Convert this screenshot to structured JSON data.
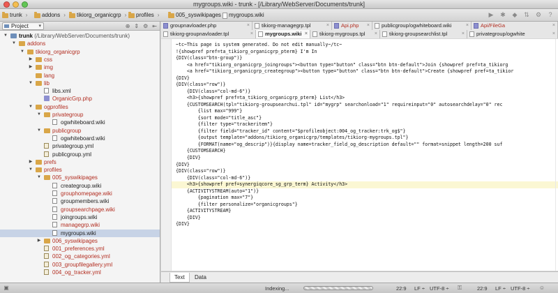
{
  "window": {
    "title": "mygroups.wiki - trunk - [/Library/WebServer/Documents/trunk]"
  },
  "breadcrumb": [
    "trunk",
    "addons",
    "tikiorg_organicgrp",
    "profiles",
    "005_syswikipages",
    "mygroups.wiki"
  ],
  "project_pane": {
    "view_label": "Project",
    "tree": [
      {
        "label": "trunk",
        "path": " (/Library/WebServer/Documents/trunk)",
        "depth": 0,
        "arrow": "▼",
        "icon": "folder-blue",
        "style": "bold"
      },
      {
        "label": "addons",
        "depth": 1,
        "arrow": "▼",
        "icon": "folder-yellow",
        "style": "red"
      },
      {
        "label": "tikiorg_organicgrp",
        "depth": 2,
        "arrow": "▼",
        "icon": "folder-yellow",
        "style": "red"
      },
      {
        "label": "css",
        "depth": 3,
        "arrow": "▶",
        "icon": "folder-yellow",
        "style": "red"
      },
      {
        "label": "img",
        "depth": 3,
        "arrow": "▶",
        "icon": "folder-yellow",
        "style": "red"
      },
      {
        "label": "lang",
        "depth": 3,
        "arrow": "",
        "icon": "folder-yellow",
        "style": "red"
      },
      {
        "label": "lib",
        "depth": 3,
        "arrow": "▼",
        "icon": "folder-yellow",
        "style": "red"
      },
      {
        "label": "libs.xml",
        "depth": 4,
        "arrow": "",
        "icon": "file-doc",
        "style": "normal"
      },
      {
        "label": "OrganicGrp.php",
        "depth": 4,
        "arrow": "",
        "icon": "file-php",
        "style": "red"
      },
      {
        "label": "ogprofiles",
        "depth": 3,
        "arrow": "▼",
        "icon": "folder-yellow",
        "style": "red"
      },
      {
        "label": "privategroup",
        "depth": 4,
        "arrow": "▼",
        "icon": "folder-yellow",
        "style": "red"
      },
      {
        "label": "ogwhiteboard.wiki",
        "depth": 5,
        "arrow": "",
        "icon": "file-doc",
        "style": "normal"
      },
      {
        "label": "publicgroup",
        "depth": 4,
        "arrow": "▼",
        "icon": "folder-yellow",
        "style": "red"
      },
      {
        "label": "ogwhiteboard.wiki",
        "depth": 5,
        "arrow": "",
        "icon": "file-doc",
        "style": "normal"
      },
      {
        "label": "privategroup.yml",
        "depth": 4,
        "arrow": "",
        "icon": "file-yml",
        "style": "normal"
      },
      {
        "label": "publicgroup.yml",
        "depth": 4,
        "arrow": "",
        "icon": "file-yml",
        "style": "normal"
      },
      {
        "label": "prefs",
        "depth": 3,
        "arrow": "▶",
        "icon": "folder-yellow",
        "style": "red"
      },
      {
        "label": "profiles",
        "depth": 3,
        "arrow": "▼",
        "icon": "folder-yellow",
        "style": "red"
      },
      {
        "label": "005_syswikipages",
        "depth": 4,
        "arrow": "▼",
        "icon": "folder-yellow",
        "style": "red"
      },
      {
        "label": "creategroup.wiki",
        "depth": 5,
        "arrow": "",
        "icon": "file-doc",
        "style": "normal"
      },
      {
        "label": "grouphomepage.wiki",
        "depth": 5,
        "arrow": "",
        "icon": "file-doc",
        "style": "red"
      },
      {
        "label": "groupmembers.wiki",
        "depth": 5,
        "arrow": "",
        "icon": "file-doc",
        "style": "normal"
      },
      {
        "label": "groupsearchpage.wiki",
        "depth": 5,
        "arrow": "",
        "icon": "file-doc",
        "style": "red"
      },
      {
        "label": "joingroups.wiki",
        "depth": 5,
        "arrow": "",
        "icon": "file-doc",
        "style": "normal"
      },
      {
        "label": "managegrp.wiki",
        "depth": 5,
        "arrow": "",
        "icon": "file-doc",
        "style": "red"
      },
      {
        "label": "mygroups.wiki",
        "depth": 5,
        "arrow": "",
        "icon": "file-doc",
        "style": "normal",
        "selected": true
      },
      {
        "label": "006_syswikipages",
        "depth": 4,
        "arrow": "▶",
        "icon": "folder-yellow",
        "style": "red"
      },
      {
        "label": "001_preferences.yml",
        "depth": 4,
        "arrow": "",
        "icon": "file-yml",
        "style": "red"
      },
      {
        "label": "002_og_categories.yml",
        "depth": 4,
        "arrow": "",
        "icon": "file-yml",
        "style": "red"
      },
      {
        "label": "003_groupfilegallery.yml",
        "depth": 4,
        "arrow": "",
        "icon": "file-yml",
        "style": "red"
      },
      {
        "label": "004_og_tracker.yml",
        "depth": 4,
        "arrow": "",
        "icon": "file-yml",
        "style": "red"
      }
    ]
  },
  "tabs_row1": [
    {
      "label": "groupnavloader.php",
      "kind": "php",
      "style": "normal"
    },
    {
      "label": "tikiorg-managegrp.tpl",
      "kind": "doc",
      "style": "normal"
    },
    {
      "label": "Api.php",
      "kind": "php",
      "style": "red"
    },
    {
      "label": "publicgroup/ogwhiteboard.wiki",
      "kind": "doc",
      "style": "normal"
    },
    {
      "label": "Api/FileGa",
      "kind": "php",
      "style": "red"
    }
  ],
  "tabs_row2": [
    {
      "label": "tikiorg-groupnavloader.tpl",
      "kind": "doc",
      "style": "normal"
    },
    {
      "label": "mygroups.wiki",
      "kind": "doc",
      "style": "normal",
      "active": true
    },
    {
      "label": "tikiorg-mygroups.tpl",
      "kind": "doc",
      "style": "normal"
    },
    {
      "label": "tikiorg-groupsearchlist.tpl",
      "kind": "doc",
      "style": "normal"
    },
    {
      "label": "privategroup/ogwhite",
      "kind": "doc",
      "style": "normal"
    }
  ],
  "code_lines": [
    "~tc~This page is system generated. Do not edit manually~/tc~",
    "!{showpref pref=ta_tikiorg_organicgrp_pterm} I'm In",
    "{DIV(class=\"btn-group\")}",
    "    <a href=\"tikiorg_organicgrp_joingroups\"><button type=\"button\" class=\"btn btn-default\">Join {showpref pref=ta_tikiorg",
    "    <a href=\"tikiorg_organicgrp_creategroup\"><button type=\"button\" class=\"btn btn-default\">Create {showpref pref=ta_tikior",
    "{DIV}",
    "{DIV(class=\"row\")}",
    "    {DIV(class=\"col-md-6\")}",
    "    <h3>{showpref pref=ta_tikiorg_organicgrp_pterm} List</h3>",
    "    {CUSTOMSEARCH(tpl=\"tikiorg-groupsearchui.tpl\" id=\"mygrp\" searchonload=\"1\" requireinput=\"0\" autosearchdelay=\"0\" rec",
    "        {list max=\"999\"}",
    "        {sort mode=\"title_asc\"}",
    "        {filter type=\"trackeritem\"}",
    "        {filter field=\"tracker_id\" content=\"$profileobject:004_og_tracker:trk_og$\"}",
    "        {output template=\"addons/tikiorg_organicgrp/templates/tikiorg-mygroups.tpl\"}",
    "        {FORMAT(name=\"og_descrip\")}{display name=tracker_field_og_description default=\"\" format=snippet length=200 suf",
    "    {CUSTOMSEARCH}",
    "    {DIV}",
    "{DIV}",
    "{DIV(class=\"row\")}",
    "    {DIV(class=\"col-md-6\")}",
    "    <h3>{showpref pref=synergiqcore_sg_grp_term} Activity</h3>",
    "    {ACTIVITYSTREAM(auto=\"1\")}",
    "        {pagination max=\"7\"}",
    "        {filter personalize=\"organicgroups\"}",
    "    {ACTIVITYSTREAM}",
    "    {DIV}",
    "{DIV}"
  ],
  "current_line_index": 21,
  "bottom_tabs": [
    {
      "label": "Text",
      "active": true
    },
    {
      "label": "Data",
      "active": false
    }
  ],
  "status": {
    "indexing": "Indexing...",
    "position": "22:9",
    "line_sep": "LF ÷",
    "encoding": "UTF-8 ÷",
    "position2": "22:9",
    "line_sep2": "LF ÷",
    "encoding2": "UTF-8 ÷"
  },
  "colors": {
    "modified": "#b22d20",
    "selection": "#c7d3e6",
    "current_line": "#fbf7d3"
  }
}
